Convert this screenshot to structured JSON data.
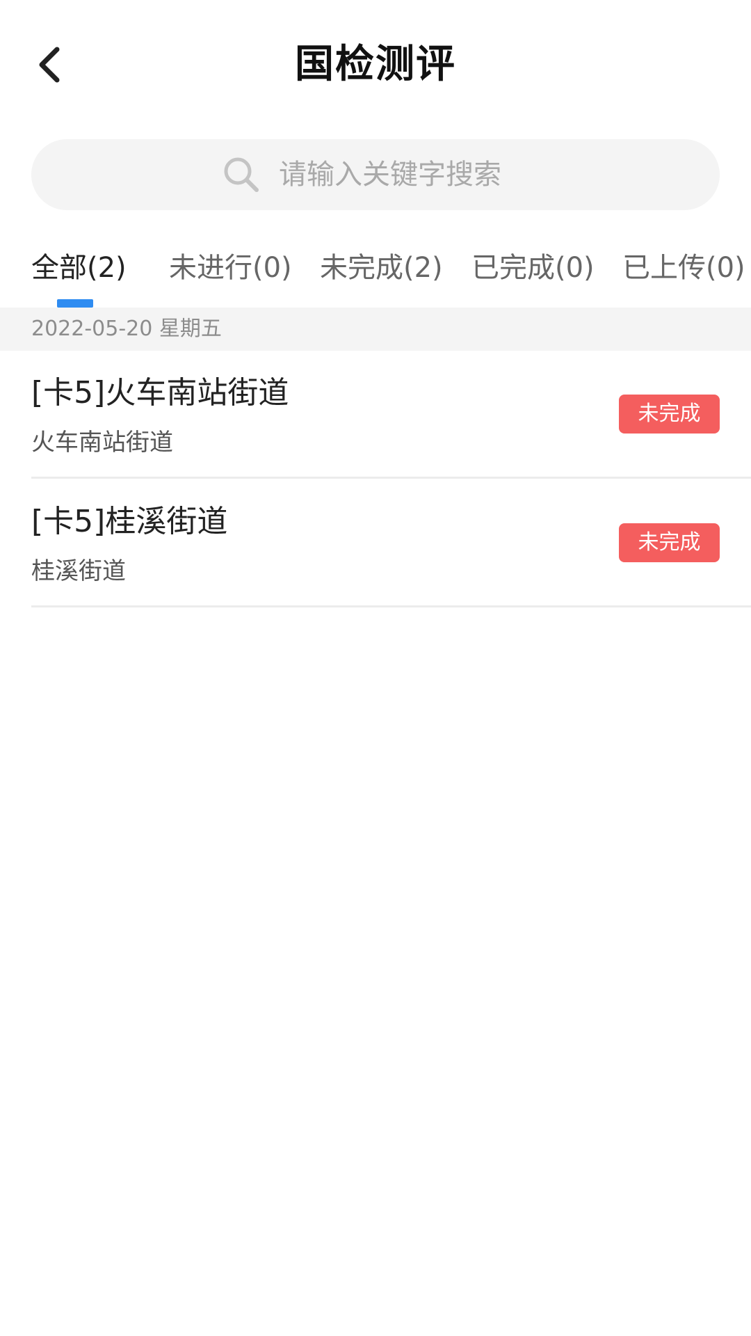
{
  "header": {
    "title": "国检测评"
  },
  "search": {
    "placeholder": "请输入关键字搜索"
  },
  "tabs": [
    {
      "label": "全部(2)",
      "active": true
    },
    {
      "label": "未进行(0)",
      "active": false
    },
    {
      "label": "未完成(2)",
      "active": false
    },
    {
      "label": "已完成(0)",
      "active": false
    },
    {
      "label": "已上传(0)",
      "active": false
    }
  ],
  "date_header": "2022-05-20 星期五",
  "items": [
    {
      "title": "[卡5]火车南站街道",
      "subtitle": "火车南站街道",
      "status": "未完成"
    },
    {
      "title": "[卡5]桂溪街道",
      "subtitle": "桂溪街道",
      "status": "未完成"
    }
  ],
  "colors": {
    "accent": "#2f8cf1",
    "status_incomplete": "#f45e5e",
    "search_bg": "#f4f4f4"
  },
  "icons": {
    "back": "chevron-left-icon",
    "search": "search-icon"
  }
}
